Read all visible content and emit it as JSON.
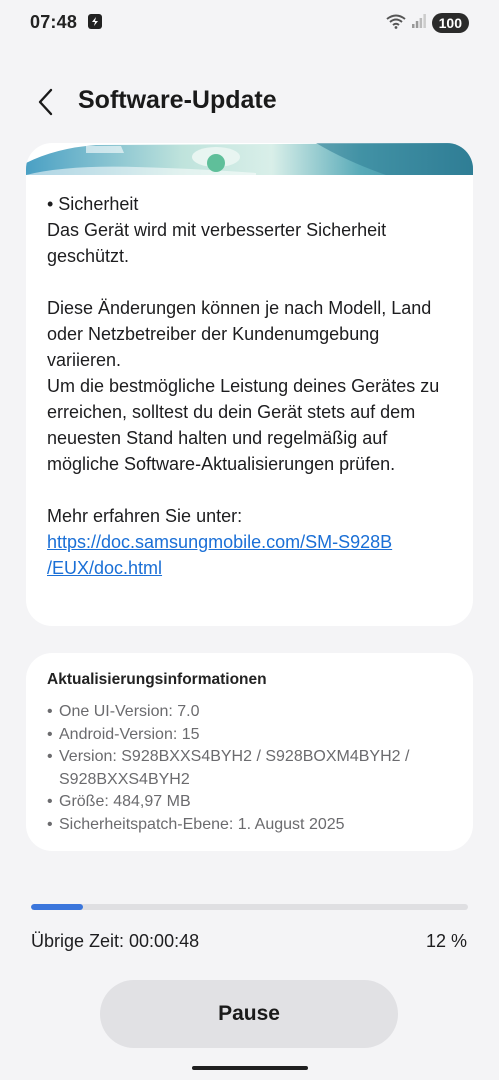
{
  "status_bar": {
    "time": "07:48",
    "battery": "100",
    "icons": [
      "app-notification-icon",
      "wifi-icon",
      "signal-icon"
    ]
  },
  "header": {
    "title": "Software-Update",
    "back_icon": "chevron-left-icon"
  },
  "release_notes": {
    "banner_colors": [
      "#3a8fb0",
      "#cfe7e1",
      "#2f7d95"
    ],
    "heading": "• Sicherheit",
    "line1": "Das Gerät wird mit verbesserter Sicherheit geschützt.",
    "para2": "Diese Änderungen können je nach Modell, Land oder Netzbetreiber der Kundenumgebung variieren.",
    "para3": "Um die bestmögliche Leistung deines Gerätes zu erreichen, solltest du dein Gerät stets auf dem neuesten Stand halten und regelmäßig auf mögliche Software-Aktualisierungen prüfen.",
    "more_label": "Mehr erfahren Sie unter:",
    "link_part1": "https://doc.samsungmobile.com/SM-S928B",
    "link_part2": "/EUX/doc.html"
  },
  "update_info": {
    "title": "Aktualisierungsinformationen",
    "items": [
      "One UI-Version: 7.0",
      "Android-Version: 15",
      "Version: S928BXXS4BYH2 / S928BOXM4BYH2 / S928BXXS4BYH2",
      "Größe: 484,97 MB",
      "Sicherheitspatch-Ebene: 1. August 2025"
    ]
  },
  "progress": {
    "fraction": 0.12,
    "remaining_text": "Übrige Zeit: 00:00:48",
    "percent_text": "12 %",
    "color": "#3b76dc"
  },
  "actions": {
    "pause_label": "Pause"
  }
}
